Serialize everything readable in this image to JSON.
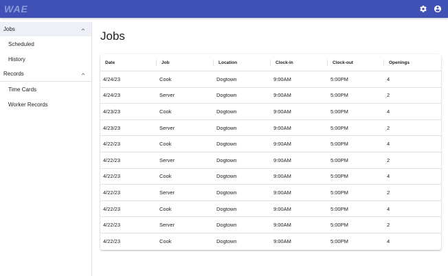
{
  "app": {
    "logo_text": "WAE",
    "bar_color": "#3f51b5"
  },
  "header": {
    "settings_icon": "gear-icon",
    "account_icon": "account-circle-icon"
  },
  "sidebar": {
    "groups": [
      {
        "label": "Jobs",
        "expanded": true,
        "items": [
          {
            "label": "Scheduled"
          },
          {
            "label": "History"
          }
        ]
      },
      {
        "label": "Records",
        "expanded": true,
        "items": [
          {
            "label": "Time Cards"
          },
          {
            "label": "Worker Records"
          }
        ]
      }
    ]
  },
  "main": {
    "title": "Jobs",
    "table": {
      "headers": [
        "Date",
        "Job",
        "Location",
        "Clock-in",
        "Clock-out",
        "Openings"
      ],
      "rows": [
        [
          "4/24/23",
          "Cook",
          "Dogtown",
          "9:00AM",
          "5:00PM",
          "4"
        ],
        [
          "4/24/23",
          "Server",
          "Dogtown",
          "9:00AM",
          "5:00PM",
          "2"
        ],
        [
          "4/23/23",
          "Cook",
          "Dogtown",
          "9:00AM",
          "5:00PM",
          "4"
        ],
        [
          "4/23/23",
          "Server",
          "Dogtown",
          "9:00AM",
          "5:00PM",
          "2"
        ],
        [
          "4/22/23",
          "Cook",
          "Dogtown",
          "9:00AM",
          "5:00PM",
          "4"
        ],
        [
          "4/22/23",
          "Server",
          "Dogtown",
          "9:00AM",
          "5:00PM",
          "2"
        ],
        [
          "4/22/23",
          "Cook",
          "Dogtown",
          "9:00AM",
          "5:00PM",
          "4"
        ],
        [
          "4/22/23",
          "Server",
          "Dogtown",
          "9:00AM",
          "5:00PM",
          "2"
        ],
        [
          "4/22/23",
          "Cook",
          "Dogtown",
          "9:00AM",
          "5:00PM",
          "4"
        ],
        [
          "4/22/23",
          "Server",
          "Dogtown",
          "9:00AM",
          "5:00PM",
          "2"
        ],
        [
          "4/22/23",
          "Cook",
          "Dogtown",
          "9:00AM",
          "5:00PM",
          "4"
        ]
      ]
    }
  }
}
